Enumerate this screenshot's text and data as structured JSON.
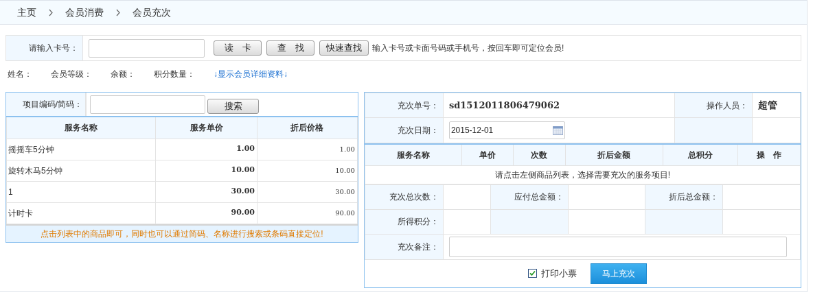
{
  "breadcrumb": [
    "主页",
    "会员消费",
    "会员充次"
  ],
  "card_search": {
    "label": "请输入卡号：",
    "buttons": [
      "读　卡",
      "查　找",
      "快速查找"
    ],
    "hint": "输入卡号或卡面号码或手机号，按回车即可定位会员!"
  },
  "member_info": {
    "fields": [
      "姓名：",
      "会员等级：",
      "余额：",
      "积分数量："
    ],
    "link": "↓显示会员详细资料↓"
  },
  "service_list": {
    "search_label": "项目编码/简码：",
    "search_button": "搜索",
    "columns": [
      "服务名称",
      "服务单价",
      "折后价格"
    ],
    "rows": [
      {
        "name": "摇摇车5分钟",
        "price": "1.00",
        "discount_price": "1.00"
      },
      {
        "name": "旋转木马5分钟",
        "price": "10.00",
        "discount_price": "10.00"
      },
      {
        "name": "1",
        "price": "30.00",
        "discount_price": "30.00"
      },
      {
        "name": "计时卡",
        "price": "90.00",
        "discount_price": "90.00"
      }
    ],
    "footer_note": "点击列表中的商品即可，同时也可以通过简码、名称进行搜索或条码直接定位!"
  },
  "recharge": {
    "order_label": "充次单号：",
    "order_no": "sd1512011806479062",
    "operator_label": "操作人员：",
    "operator": "超管",
    "date_label": "充次日期：",
    "date": "2015-12-01",
    "columns": [
      "服务名称",
      "单价",
      "次数",
      "折后金额",
      "总积分",
      "操　作"
    ],
    "empty_message": "请点击左侧商品列表，选择需要充次的服务项目!",
    "totals": [
      "充次总次数：",
      "应付总金额：",
      "折后总金额：",
      "所得积分："
    ],
    "notes_label": "充次备注：",
    "print_receipt": {
      "label": "打印小票",
      "checked": true
    },
    "submit": "马上充次"
  }
}
